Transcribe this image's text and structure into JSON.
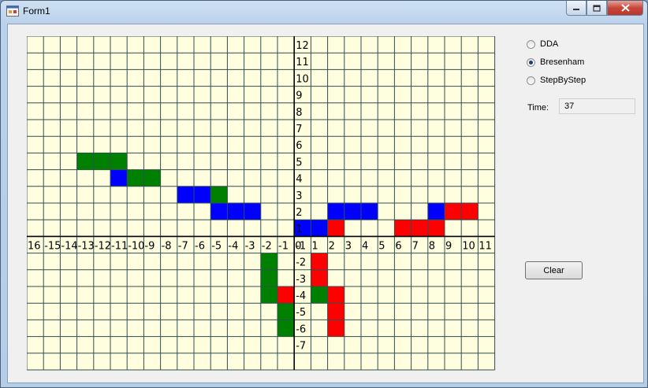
{
  "window": {
    "title": "Form1"
  },
  "controls": {
    "radios": [
      {
        "label": "DDA",
        "checked": false
      },
      {
        "label": "Bresenham",
        "checked": true
      },
      {
        "label": "StepByStep",
        "checked": false
      }
    ],
    "time_label": "Time:",
    "time_value": "37",
    "clear_label": "Clear"
  },
  "grid": {
    "x_min": -16,
    "x_max": 11,
    "y_min": -7,
    "y_max": 12,
    "background": "#ffffe0",
    "line_color": "#2f4f4f",
    "x_tick_labels": [
      "16",
      "-15",
      "-14",
      "-13",
      "-12",
      "-11",
      "-10",
      "-9",
      "-8",
      "-7",
      "-6",
      "-5",
      "-4",
      "-3",
      "-2",
      "-1",
      "0",
      "1",
      "2",
      "3",
      "4",
      "5",
      "6",
      "7",
      "8",
      "9",
      "10",
      "11",
      "1"
    ],
    "y_tick_labels": [
      "12",
      "11",
      "10",
      "9",
      "8",
      "7",
      "6",
      "5",
      "4",
      "3",
      "2",
      "1",
      "-1",
      "-2",
      "-3",
      "-4",
      "-5",
      "-6",
      "-7"
    ],
    "colors": {
      "green": "#008000",
      "blue": "#0000ff",
      "red": "#ff0000"
    },
    "cells": [
      {
        "x": -13,
        "y": 5,
        "c": "green"
      },
      {
        "x": -12,
        "y": 5,
        "c": "green"
      },
      {
        "x": -11,
        "y": 5,
        "c": "green"
      },
      {
        "x": -11,
        "y": 4,
        "c": "blue"
      },
      {
        "x": -10,
        "y": 4,
        "c": "green"
      },
      {
        "x": -9,
        "y": 4,
        "c": "green"
      },
      {
        "x": -7,
        "y": 3,
        "c": "blue"
      },
      {
        "x": -6,
        "y": 3,
        "c": "blue"
      },
      {
        "x": -5,
        "y": 3,
        "c": "green"
      },
      {
        "x": -5,
        "y": 2,
        "c": "blue"
      },
      {
        "x": -4,
        "y": 2,
        "c": "blue"
      },
      {
        "x": -3,
        "y": 2,
        "c": "blue"
      },
      {
        "x": 0,
        "y": 1,
        "c": "blue"
      },
      {
        "x": 1,
        "y": 1,
        "c": "blue"
      },
      {
        "x": 2,
        "y": 1,
        "c": "red"
      },
      {
        "x": 2,
        "y": 2,
        "c": "blue"
      },
      {
        "x": 3,
        "y": 2,
        "c": "blue"
      },
      {
        "x": 4,
        "y": 2,
        "c": "blue"
      },
      {
        "x": 6,
        "y": 1,
        "c": "red"
      },
      {
        "x": 7,
        "y": 1,
        "c": "red"
      },
      {
        "x": 8,
        "y": 1,
        "c": "red"
      },
      {
        "x": 8,
        "y": 2,
        "c": "blue"
      },
      {
        "x": 9,
        "y": 2,
        "c": "red"
      },
      {
        "x": 10,
        "y": 2,
        "c": "red"
      },
      {
        "x": -2,
        "y": -1,
        "c": "green"
      },
      {
        "x": -2,
        "y": -2,
        "c": "green"
      },
      {
        "x": -2,
        "y": -3,
        "c": "green"
      },
      {
        "x": -1,
        "y": -3,
        "c": "red"
      },
      {
        "x": -1,
        "y": -4,
        "c": "green"
      },
      {
        "x": -1,
        "y": -5,
        "c": "green"
      },
      {
        "x": 1,
        "y": -1,
        "c": "red"
      },
      {
        "x": 1,
        "y": -2,
        "c": "red"
      },
      {
        "x": 1,
        "y": -3,
        "c": "green"
      },
      {
        "x": 2,
        "y": -3,
        "c": "red"
      },
      {
        "x": 2,
        "y": -4,
        "c": "red"
      },
      {
        "x": 2,
        "y": -5,
        "c": "red"
      }
    ]
  }
}
